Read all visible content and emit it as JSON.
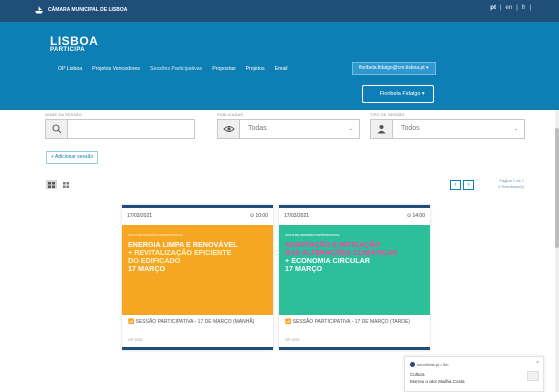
{
  "topbar": {
    "brand": "CÂMARA MUNICIPAL DE LISBOA",
    "langs": [
      "pt",
      "|",
      "en",
      "|",
      "fr",
      "|"
    ]
  },
  "header": {
    "logo_line1": "LISBOA",
    "logo_line2": "PARTICIPA",
    "nav": [
      "OP Lisboa",
      "Projetos Vencedores",
      "Sessões Participativas",
      "Propostas",
      "Projetos",
      "Email"
    ],
    "user_email": "floribela.fidalgo@cm-lisboa.pt ▾",
    "user_name": "Floribela Fidalgo ▾"
  },
  "filters": {
    "name_label": "NOME DA SESSÃO",
    "name_value": "",
    "published_label": "PUBLICADAS",
    "published_value": "Todas",
    "type_label": "TIPO DE SESSÃO",
    "type_value": "Todos"
  },
  "actions": {
    "add_session": "+ Adicionar sessão"
  },
  "pager": {
    "prev": "‹",
    "next": "›",
    "page_info": "Página 1 de 1",
    "results": "4 Resultado(s)"
  },
  "cards": [
    {
      "date": "17/03/2021",
      "time": "⊙ 10:00",
      "banner_small": "CICLO DE SESSÕES PARTICIPATIVAS",
      "banner_line1": "ENERGIA LIMPA E RENOVÁVEL",
      "banner_line2": "+ REVITALIZAÇÃO EFICIENTE",
      "banner_line3": "DO EDIFICADO",
      "banner_date": "17 MARÇO",
      "title": "SESSÃO PARTICIPATIVA - 17 DE MARÇO (MANHÃ)",
      "tag": "OP 2021",
      "banner_color": "#f6a623"
    },
    {
      "date": "17/03/2021",
      "time": "⊙ 14:00",
      "banner_small": "CICLO DE SESSÕES PARTICIPATIVAS",
      "banner_line1": "ADAPTAÇÃO E MITIGAÇÃO",
      "banner_line2": "DAS ALTERAÇÕES CLIMÁTICAS",
      "banner_line3": "+ ECONOMIA CIRCULAR",
      "banner_date": "17 MARÇO",
      "title": "SESSÃO PARTICIPATIVA - 17 DE MARÇO (TARDE)",
      "tag": "OP 2021",
      "banner_color": "#2cbf9a"
    }
  ],
  "toast": {
    "source": "sonoticias.pt • 9m",
    "category": "Cultura",
    "headline": "Morreu o ator Mailha Costa",
    "close": "×"
  }
}
